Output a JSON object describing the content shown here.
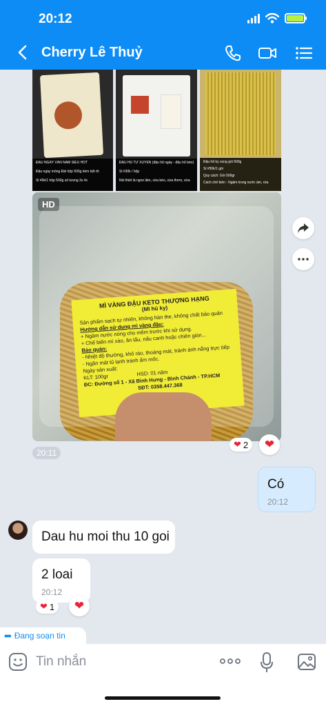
{
  "status": {
    "time": "20:12"
  },
  "header": {
    "title": "Cherry Lê Thuỷ"
  },
  "thumbs": [
    {
      "lines": [
        "ĐẬU NGÂY VÂN NAM SIÊU HOT",
        "Đậu ngày mỏng Đài hộp 500g kèm bột ớt",
        "Sỉ 45k/1 hộp 500g số lượng 3s 4x"
      ]
    },
    {
      "lines": [
        "ĐẬU HŨ TỨ XUYÊN (đậu hũ ngày - đậu hũ béo)",
        "Sỉ #30k / hộp",
        "Nói thiết là ngon lắm, vừa béo, vừa thơm, vừa"
      ]
    },
    {
      "lines": [
        "Đậu hũ ky cọng gói 500g",
        "Sỉ #50k/1 gói",
        "Quy cách: Gói 500gr",
        "Cách chế biến : Ngâm trong nước ấm, rửa"
      ]
    }
  ],
  "photo": {
    "hd": "HD",
    "label_title": "MÌ VÀNG ĐẬU KETO THƯỢNG HẠNG",
    "label_sub": "(Mì hủ ky)",
    "label_lines": [
      "Sản phẩm sạch tự nhiên, không hàn the, không chất bảo quản",
      "Hướng dẫn sử dụng mì vàng đậu:",
      "+ Ngâm nước nóng cho mềm trước khi sử dụng.",
      "+ Chế biến mì xào, ăn lẩu, nấu canh hoặc chiên giòn...",
      "Bảo quản:",
      "- Nhiệt độ thường, khô ráo, thoáng mát, tránh ánh nắng trực tiếp",
      "- Ngăn mát tủ lạnh tránh ẩm mốc.",
      "Ngày sản xuất:",
      "KLT: 100gr                    HSD: 01 năm",
      "ĐC: Đường số 1 - Xã Bình Hưng - Bình Chánh - TP.HCM",
      "SĐT: 0358.447.368"
    ]
  },
  "messages": {
    "photo_time": "20:11",
    "photo_reaction_count": "2",
    "out_text": "Có",
    "out_time": "20:12",
    "in1_text": "Dau hu moi thu 10 goi",
    "in2_text": "2 loai",
    "in2_time": "20:12",
    "in2_reaction_count": "1"
  },
  "typing": {
    "text": "Đang soạn tin"
  },
  "composer": {
    "placeholder": "Tin nhắn"
  },
  "colors": {
    "accent": "#0d8cf5",
    "heart": "#e8233a",
    "out_bubble": "#d6ecfe"
  }
}
